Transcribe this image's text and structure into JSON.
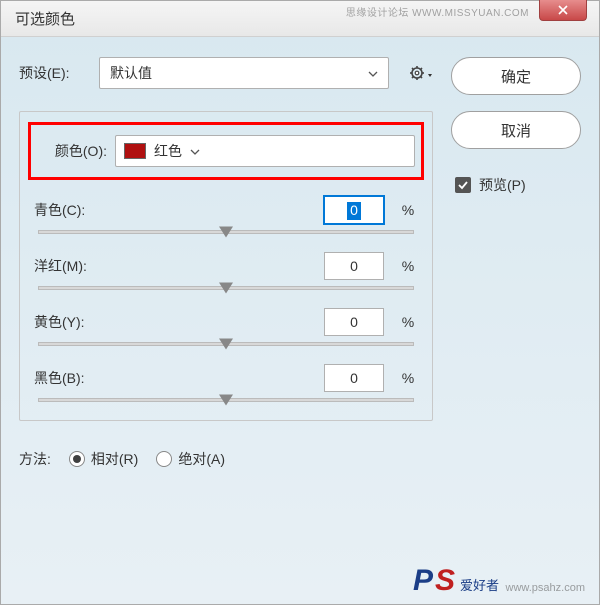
{
  "title": "可选颜色",
  "preset": {
    "label": "预设(E):",
    "value": "默认值"
  },
  "color": {
    "label": "颜色(O):",
    "value": "红色",
    "swatch": "#b01010"
  },
  "sliders": {
    "cyan": {
      "label": "青色(C):",
      "value": "0",
      "unit": "%"
    },
    "magenta": {
      "label": "洋红(M):",
      "value": "0",
      "unit": "%"
    },
    "yellow": {
      "label": "黄色(Y):",
      "value": "0",
      "unit": "%"
    },
    "black": {
      "label": "黑色(B):",
      "value": "0",
      "unit": "%"
    }
  },
  "method": {
    "label": "方法:",
    "relative": "相对(R)",
    "absolute": "绝对(A)"
  },
  "buttons": {
    "ok": "确定",
    "cancel": "取消"
  },
  "preview": {
    "label": "预览(P)"
  },
  "watermarks": {
    "top": "思缘设计论坛  WWW.MISSYUAN.COM",
    "br": "www.psahz.com",
    "logo_txt": "爱好者"
  }
}
